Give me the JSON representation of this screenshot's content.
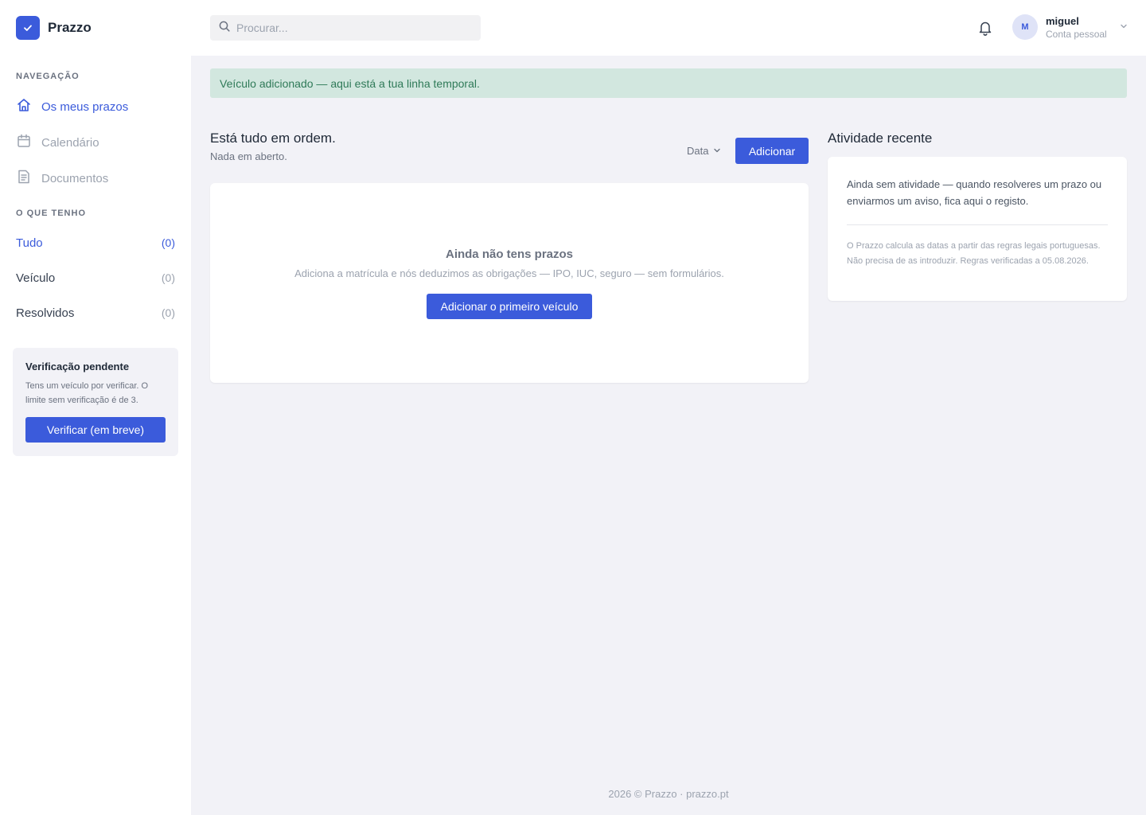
{
  "brand": {
    "name": "Prazzo"
  },
  "sidebar": {
    "nav_heading": "NAVEGAÇÃO",
    "nav_items": [
      {
        "label": "Os meus prazos",
        "icon": "home-icon",
        "active": true
      },
      {
        "label": "Calendário",
        "icon": "calendar-icon",
        "active": false
      },
      {
        "label": "Documentos",
        "icon": "document-icon",
        "active": false
      }
    ],
    "filters_heading": "O QUE TENHO",
    "filters": [
      {
        "label": "Tudo",
        "count": "(0)",
        "active": true
      },
      {
        "label": "Veículo",
        "count": "(0)",
        "active": false
      },
      {
        "label": "Resolvidos",
        "count": "(0)",
        "active": false
      }
    ],
    "verification": {
      "title": "Verificação pendente",
      "text": "Tens um veículo por verificar. O limite sem verificação é de 3.",
      "button_label": "Verificar (em breve)"
    }
  },
  "header": {
    "search_placeholder": "Procurar...",
    "user": {
      "initial": "M",
      "name": "miguel",
      "account": "Conta pessoal"
    }
  },
  "alert": {
    "text": "Veículo adicionado — aqui está a tua linha temporal."
  },
  "main": {
    "title": "Está tudo em ordem.",
    "subtitle": "Nada em aberto.",
    "sort_label": "Data",
    "add_label": "Adicionar",
    "empty": {
      "title": "Ainda não tens prazos",
      "text": "Adiciona a matrícula e nós deduzimos as obrigações — IPO, IUC, seguro — sem formulários.",
      "button_label": "Adicionar o primeiro veículo"
    }
  },
  "activity": {
    "title": "Atividade recente",
    "empty_text": "Ainda sem atividade — quando resolveres um prazo ou enviarmos um aviso, fica aqui o registo.",
    "note": "O Prazzo calcula as datas a partir das regras legais portuguesas. Não precisa de as introduzir. Regras verificadas a 05.08.2026."
  },
  "footer": {
    "text": "2026 © Prazzo · prazzo.pt"
  },
  "colors": {
    "accent": "#3b5bdb",
    "success_bg": "#d2e7df",
    "success_text": "#2f7a58",
    "page_bg": "#f2f2f7"
  }
}
